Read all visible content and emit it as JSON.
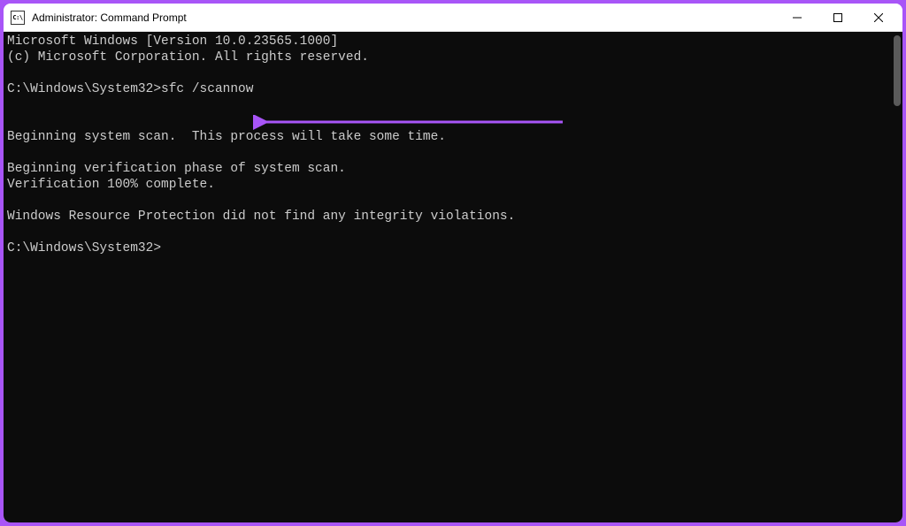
{
  "window": {
    "icon_label": "C:\\",
    "title": "Administrator: Command Prompt"
  },
  "terminal": {
    "line1": "Microsoft Windows [Version 10.0.23565.1000]",
    "line2": "(c) Microsoft Corporation. All rights reserved.",
    "blank1": "",
    "prompt1": "C:\\Windows\\System32>sfc /scannow",
    "blank2": "",
    "blank3": "",
    "line3": "Beginning system scan.  This process will take some time.",
    "blank4": "",
    "line4": "Beginning verification phase of system scan.",
    "line5": "Verification 100% complete.",
    "blank5": "",
    "line6": "Windows Resource Protection did not find any integrity violations.",
    "blank6": "",
    "prompt2": "C:\\Windows\\System32>"
  },
  "annotation": {
    "color": "#a855f7"
  }
}
